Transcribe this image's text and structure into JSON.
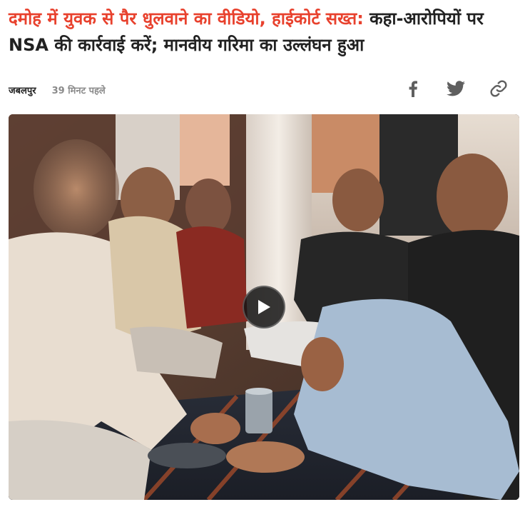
{
  "article": {
    "headline_highlight": "दमोह में युवक से पैर धुलवाने का वीडियो, हाईकोर्ट सख्त:",
    "headline_rest": " कहा-आरोपियों पर NSA की कार्रवाई करें; मानवीय गरिमा का उल्लंघन हुआ",
    "location": "जबलपुर",
    "time_ago": "39 मिनट पहले"
  },
  "share": {
    "icons": [
      "facebook-icon",
      "twitter-icon",
      "link-icon"
    ]
  },
  "video": {
    "state": "paused"
  },
  "colors": {
    "highlight": "#e8412d",
    "text": "#212121",
    "muted": "#8a8a8a",
    "icon": "#5f5f5f"
  }
}
